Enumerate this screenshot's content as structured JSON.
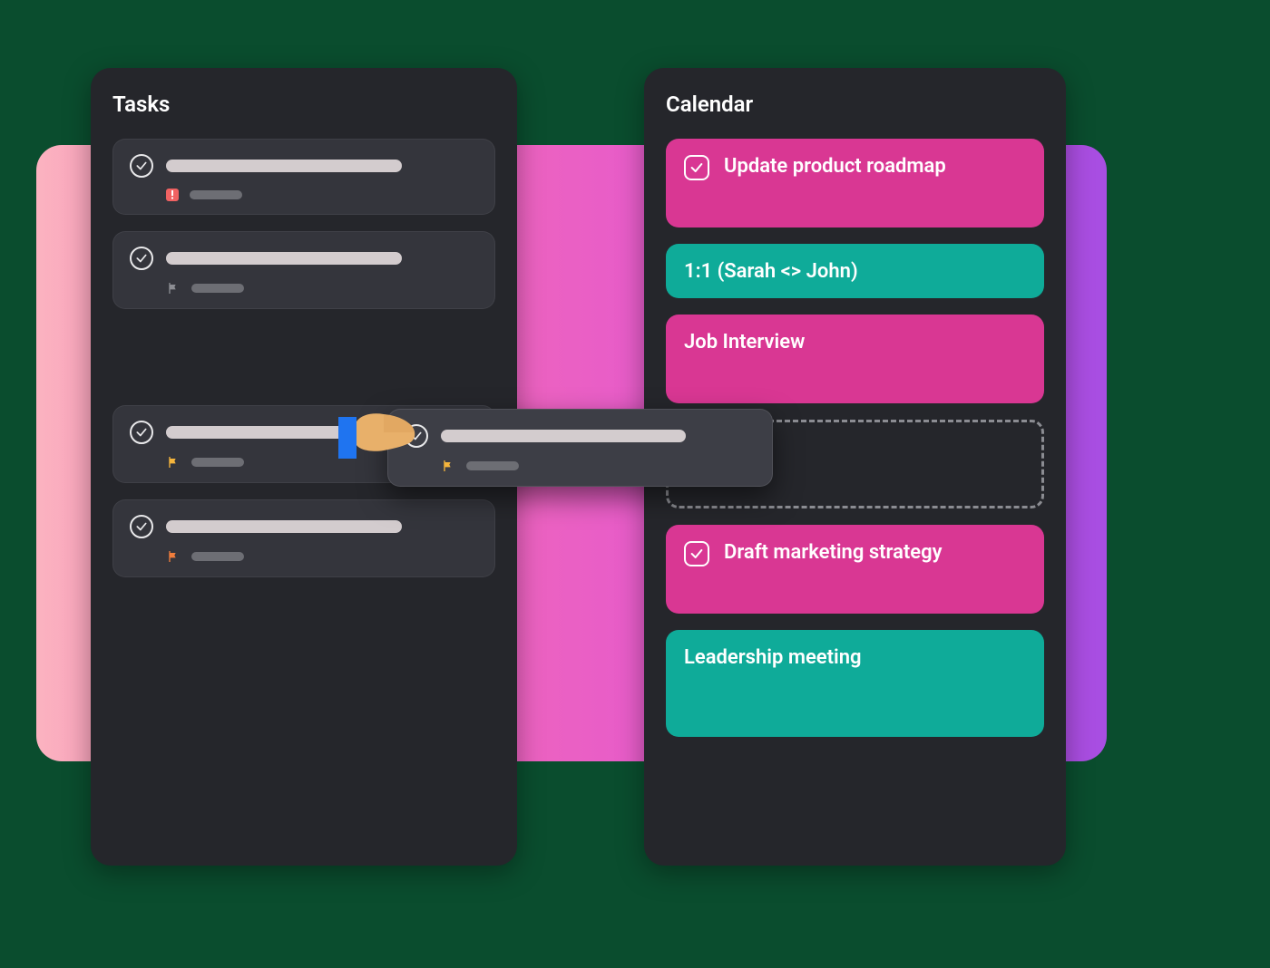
{
  "tasks_panel": {
    "title": "Tasks",
    "cards": [
      {
        "priority_marker": "urgent-red"
      },
      {
        "priority_marker": "flag-gray"
      },
      {
        "priority_marker": "flag-yellow"
      },
      {
        "priority_marker": "flag-orange"
      }
    ]
  },
  "drag_card": {
    "priority_marker": "flag-yellow"
  },
  "calendar_panel": {
    "title": "Calendar",
    "events": [
      {
        "label": "Update product roadmap",
        "color": "pink",
        "has_check": true,
        "size": "med"
      },
      {
        "label": "1:1 (Sarah <> John)",
        "color": "teal",
        "has_check": false,
        "size": "short"
      },
      {
        "label": "Job Interview",
        "color": "pink",
        "has_check": false,
        "size": "med"
      },
      {
        "label": "",
        "color": "drop",
        "has_check": false,
        "size": "med"
      },
      {
        "label": "Draft marketing strategy",
        "color": "pink",
        "has_check": true,
        "size": "med"
      },
      {
        "label": "Leadership meeting",
        "color": "teal",
        "has_check": false,
        "size": "tall"
      }
    ]
  },
  "colors": {
    "panel_bg": "#25262b",
    "card_bg": "#34353c",
    "event_pink": "#d93793",
    "event_teal": "#0fab99"
  }
}
